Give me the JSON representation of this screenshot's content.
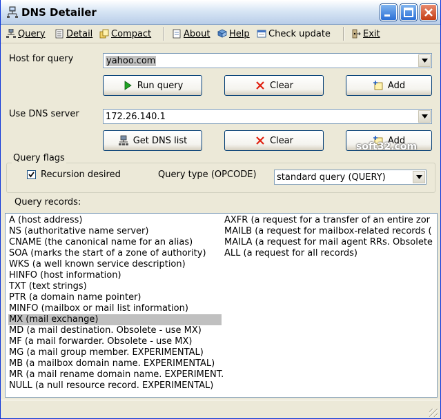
{
  "window": {
    "title": "DNS Detailer"
  },
  "menu": {
    "query": "Query",
    "detail": "Detail",
    "compact": "Compact",
    "about": "About",
    "help": "Help",
    "check_update": "Check update",
    "exit": "Exit"
  },
  "host": {
    "label": "Host for query",
    "value": "yahoo.com",
    "run_label": "Run query",
    "clear_label": "Clear",
    "add_label": "Add"
  },
  "dns": {
    "label": "Use DNS server",
    "value": "172.26.140.1",
    "get_list_label": "Get DNS list",
    "clear_label": "Clear",
    "add_label": "Add"
  },
  "flags": {
    "title": "Query flags",
    "recursion_label": "Recursion desired",
    "recursion_checked": true,
    "type_label": "Query type (OPCODE)",
    "type_value": "standard query (QUERY)"
  },
  "records": {
    "label": "Query records:",
    "selected": "MX (mail exchange)",
    "col1": [
      "A (host address)",
      "NS (authoritative name server)",
      "CNAME (the canonical name for an alias)",
      "SOA (marks the start of a zone of authority)",
      "WKS (a well known service description)",
      "HINFO (host information)",
      "TXT (text strings)",
      "PTR (a domain name pointer)",
      "MINFO (mailbox or mail list information)",
      "MX (mail exchange)",
      "MD (a mail destination. Obsolete - use MX)",
      "MF (a mail forwarder. Obsolete - use MX)",
      "MG (a mail group member. EXPERIMENTAL)",
      "MB (a mailbox domain name. EXPERIMENTAL)",
      "MR (a mail rename domain name. EXPERIMENT.",
      "NULL (a null resource record. EXPERIMENTAL)"
    ],
    "col2": [
      "AXFR (a request for a transfer of an entire zor",
      "MAILB (a request for mailbox-related records (",
      "MAILA (a request for mail agent RRs. Obsolete",
      "ALL (a request for all records)"
    ]
  },
  "watermark": "soft32.com"
}
